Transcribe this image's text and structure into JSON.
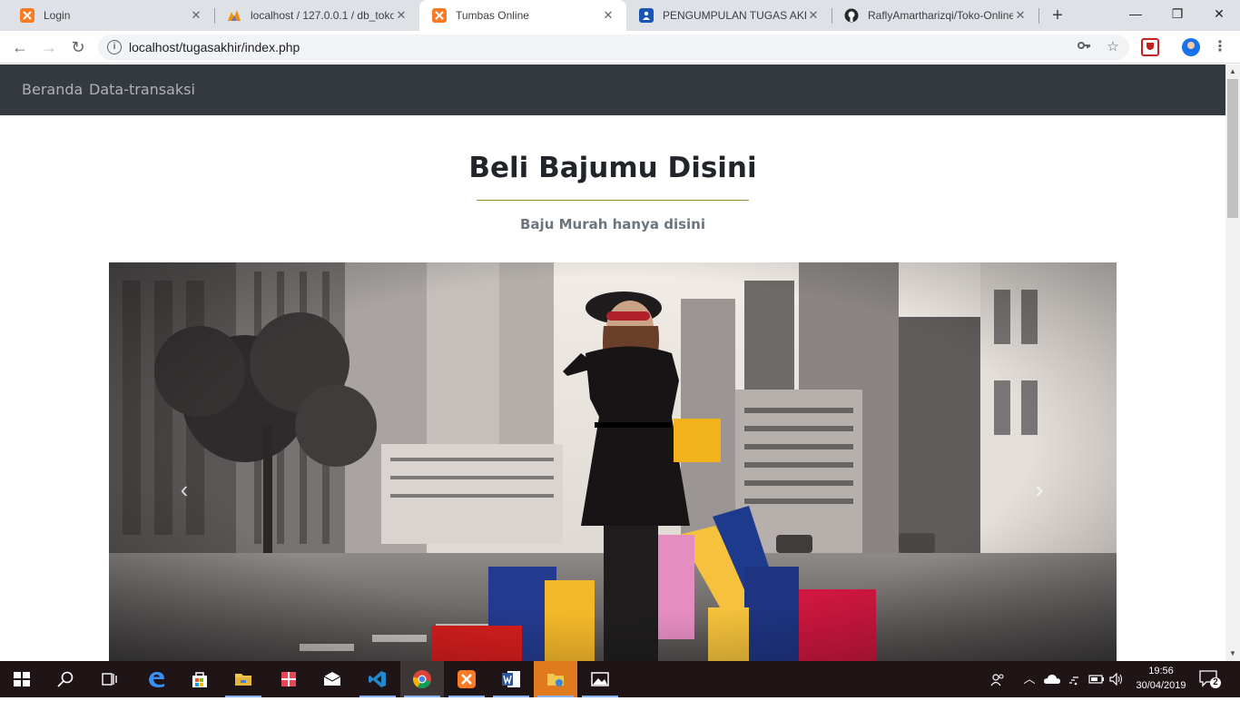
{
  "browser": {
    "tabs": [
      {
        "label": "Login",
        "icon": "xampp-icon",
        "active": false
      },
      {
        "label": "localhost / 127.0.0.1 / db_toko",
        "icon": "phpmyadmin-icon",
        "active": false
      },
      {
        "label": "Tumbas Online",
        "icon": "xampp-icon",
        "active": true
      },
      {
        "label": "PENGUMPULAN TUGAS AKHIR",
        "icon": "contact-form-icon",
        "active": false
      },
      {
        "label": "RaflyAmartharizqi/Toko-Online",
        "icon": "github-icon",
        "active": false
      }
    ],
    "address_bar": {
      "url": "localhost/tugasakhir/index.php"
    },
    "colors": {
      "tabstrip": "#dee1e6",
      "xampp_orange": "#fb7a24"
    }
  },
  "site": {
    "nav": {
      "links": [
        {
          "label": "Beranda"
        },
        {
          "label": "Data-transaksi"
        }
      ],
      "background": "#343a40"
    },
    "hero": {
      "title": "Beli Bajumu Disini",
      "subtitle": "Baju Murah hanya disini",
      "accent_line_color": "#a08a3c"
    },
    "carousel": {
      "image": "woman-shopping-bags-city-street-photo",
      "prev_icon": "chevron-left-icon",
      "next_icon": "chevron-right-icon"
    }
  },
  "taskbar": {
    "apps": [
      "windows-start-icon",
      "search-icon",
      "task-view-icon",
      "edge-icon",
      "store-icon",
      "file-explorer-icon",
      "gift-icon",
      "mail-icon",
      "vscode-icon",
      "chrome-icon",
      "xampp-icon",
      "word-icon",
      "file-manager-icon",
      "photos-icon"
    ],
    "clock": {
      "time": "19:56",
      "date": "30/04/2019"
    },
    "notification_count": "2"
  }
}
